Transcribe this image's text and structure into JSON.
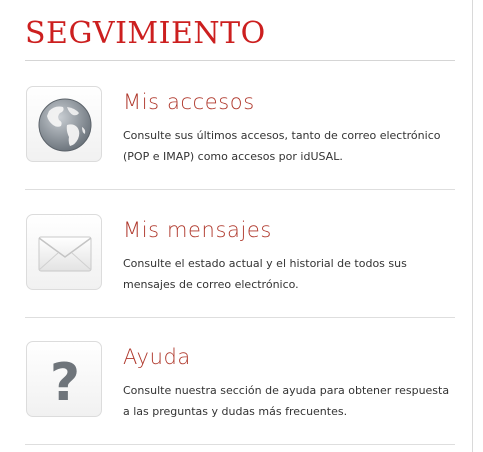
{
  "page": {
    "title": "SEGVIMIENTO"
  },
  "items": [
    {
      "title": "Mis accesos",
      "description": "Consulte sus últimos accesos, tanto de correo electrónico (POP e IMAP) como accesos por idUSAL.",
      "icon": "globe-icon"
    },
    {
      "title": "Mis mensajes",
      "description": "Consulte el estado actual y el historial de todos sus mensajes de correo electrónico.",
      "icon": "envelope-icon"
    },
    {
      "title": "Ayuda",
      "description": "Consulte nuestra sección de ayuda para obtener respuesta a las preguntas y dudas más frecuentes.",
      "icon": "question-mark-icon"
    }
  ],
  "colors": {
    "title": "#cc1f1f",
    "item_title": "#b03a2e",
    "text": "#333333",
    "divider": "#dedede"
  }
}
